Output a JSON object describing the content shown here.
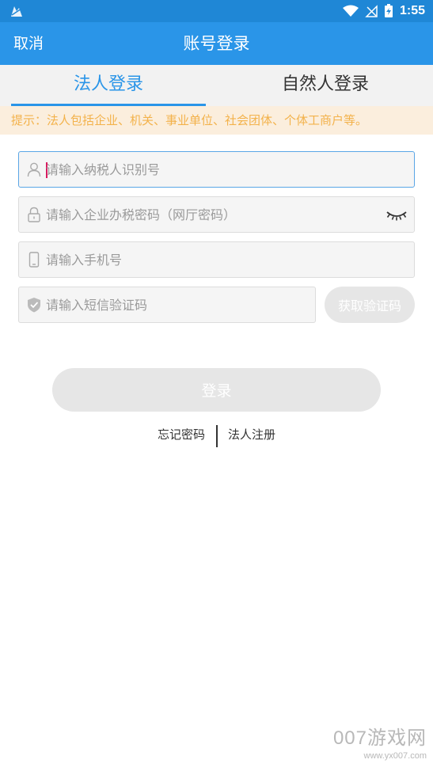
{
  "status_bar": {
    "time": "1:55",
    "icons": [
      "notification-icon",
      "wifi-icon",
      "no-signal-icon",
      "battery-charging-icon"
    ]
  },
  "header": {
    "cancel_label": "取消",
    "title": "账号登录"
  },
  "tabs": [
    {
      "label": "法人登录",
      "active": true
    },
    {
      "label": "自然人登录",
      "active": false
    }
  ],
  "hint": "提示：法人包括企业、机关、事业单位、社会团体、个体工商户等。",
  "form": {
    "taxpayer_id": {
      "placeholder": "请输入纳税人识别号",
      "value": "",
      "icon": "user-icon"
    },
    "password": {
      "placeholder": "请输入企业办税密码（网厅密码）",
      "value": "",
      "icon": "lock-icon"
    },
    "phone": {
      "placeholder": "请输入手机号",
      "value": "",
      "icon": "phone-icon"
    },
    "sms_code": {
      "placeholder": "请输入短信验证码",
      "value": "",
      "icon": "shield-check-icon"
    },
    "get_code_label": "获取验证码",
    "login_label": "登录"
  },
  "links": {
    "forgot_password": "忘记密码",
    "register": "法人注册"
  },
  "watermark": {
    "brand": "007游戏网",
    "url": "www.yx007.com"
  },
  "colors": {
    "primary": "#2a95e8",
    "hint_text": "#f3b24b",
    "hint_bg": "#fbeedd",
    "disabled_button": "#e6e6e6"
  }
}
